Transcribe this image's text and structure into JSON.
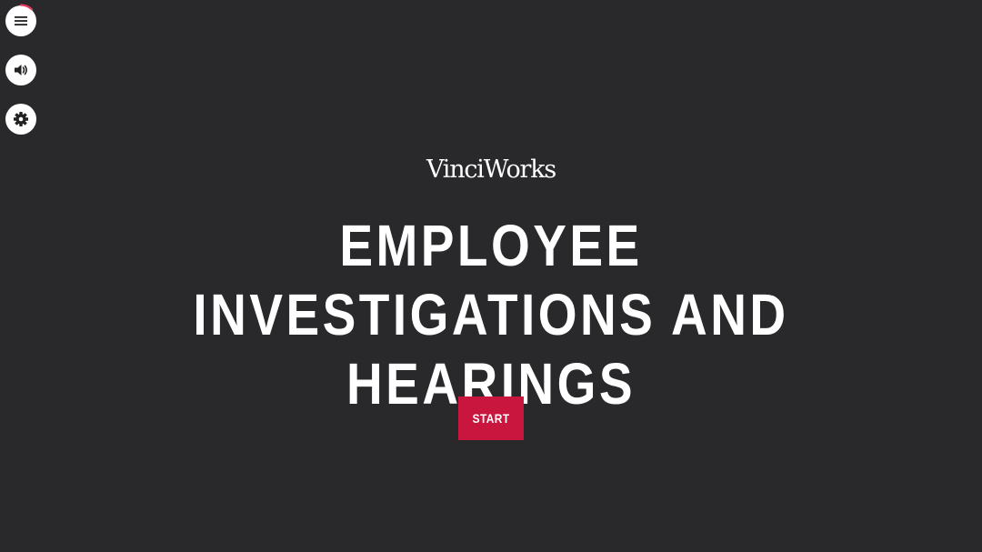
{
  "controls": {
    "menu_icon": "hamburger-icon",
    "audio_icon": "speaker-icon",
    "settings_icon": "gear-icon",
    "progress_fraction": 0.12,
    "progress_color": "#e63a5c"
  },
  "logo": {
    "text": "VinciWorks"
  },
  "hero": {
    "title": "EMPLOYEE INVESTIGATIONS AND HEARINGS",
    "start_label": "START"
  },
  "colors": {
    "background": "#29282b",
    "accent": "#c8163f",
    "text": "#ffffff"
  }
}
